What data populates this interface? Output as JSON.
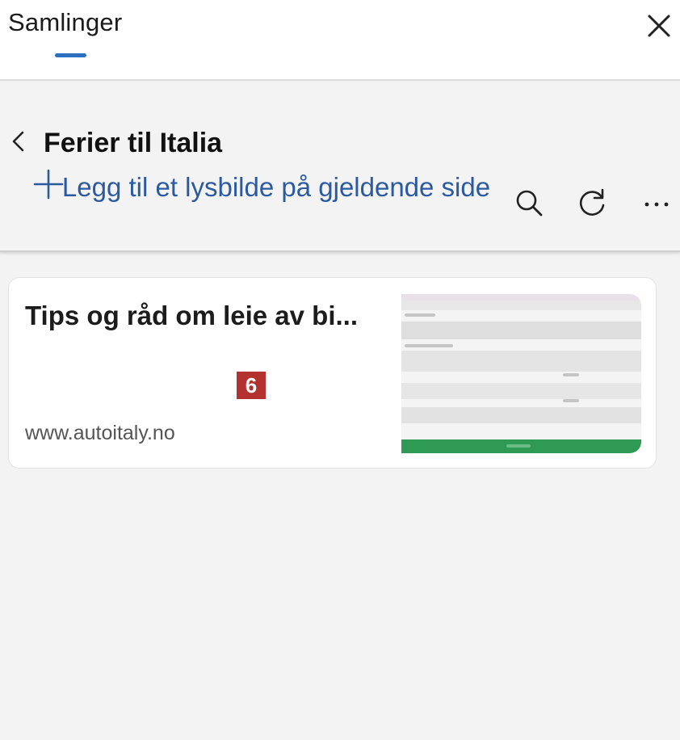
{
  "app": {
    "title": "Samlinger",
    "accent_color": "#2f6fbf",
    "close_icon": "close-icon"
  },
  "collection": {
    "title": "Ferier til Italia",
    "add_label": "Legg til et lysbilde på gjeldende side",
    "tools": [
      "search-icon",
      "refresh-icon",
      "more-icon"
    ]
  },
  "items": [
    {
      "title": "Tips og råd om leie av bi...",
      "url": "www.autoitaly.no",
      "badge": "6",
      "badge_color": "#b3322f",
      "thumbnail_accent": "#2e9a53"
    }
  ]
}
